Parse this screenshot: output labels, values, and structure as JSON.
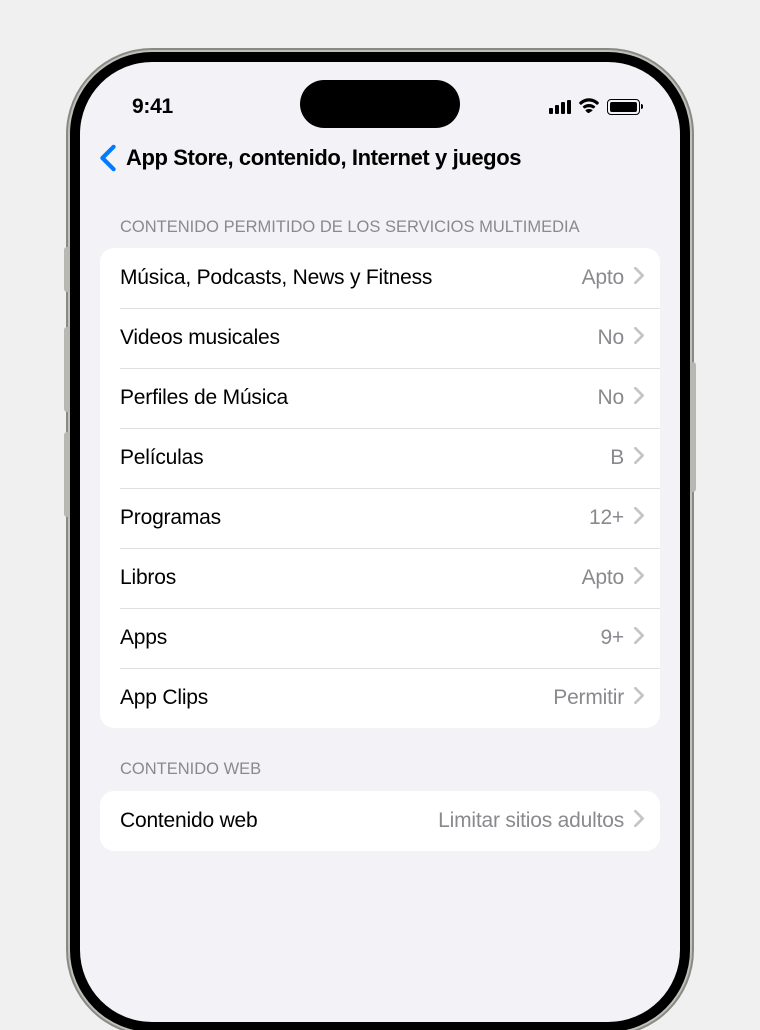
{
  "statusBar": {
    "time": "9:41"
  },
  "navBar": {
    "title": "App Store, contenido, Internet y juegos"
  },
  "sections": [
    {
      "header": "CONTENIDO PERMITIDO DE LOS SERVICIOS MULTIMEDIA",
      "rows": [
        {
          "label": "Música, Podcasts, News y Fitness",
          "value": "Apto"
        },
        {
          "label": "Videos musicales",
          "value": "No"
        },
        {
          "label": "Perfiles de Música",
          "value": "No"
        },
        {
          "label": "Películas",
          "value": "B"
        },
        {
          "label": "Programas",
          "value": "12+"
        },
        {
          "label": "Libros",
          "value": "Apto"
        },
        {
          "label": "Apps",
          "value": "9+"
        },
        {
          "label": "App Clips",
          "value": "Permitir"
        }
      ]
    },
    {
      "header": "CONTENIDO WEB",
      "rows": [
        {
          "label": "Contenido web",
          "value": "Limitar sitios adultos"
        }
      ]
    }
  ]
}
